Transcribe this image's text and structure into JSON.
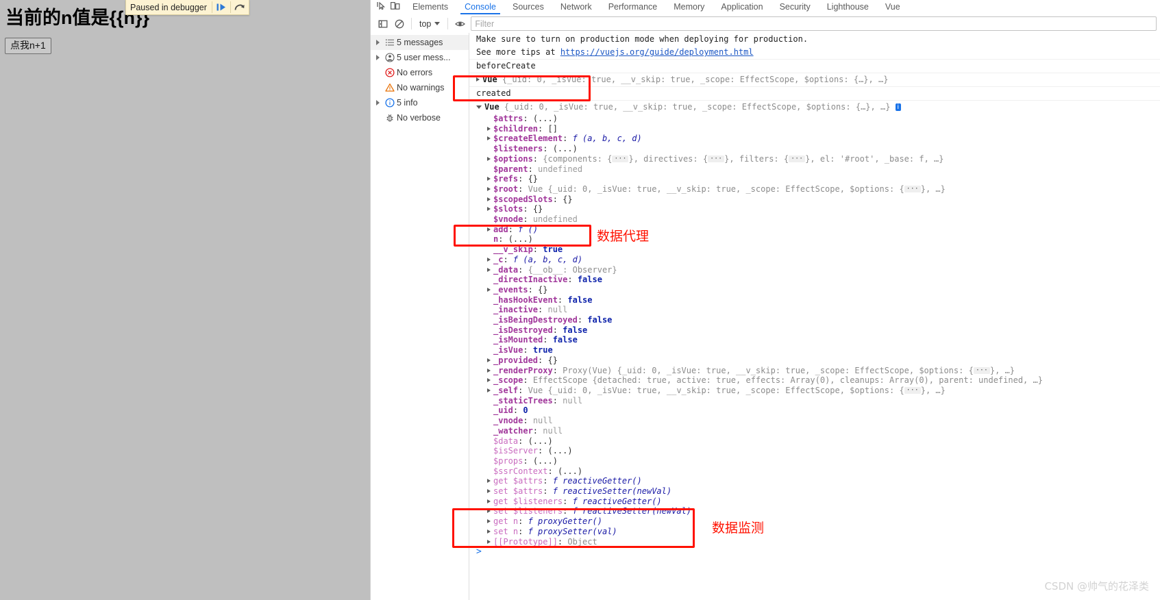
{
  "page": {
    "heading": "当前的n值是{{n}}",
    "button_label": "点我n+1",
    "background_color": "#bfbfbf"
  },
  "paused_overlay": {
    "text": "Paused in debugger",
    "resume_icon": "resume-script-icon",
    "step_over_icon": "step-over-icon"
  },
  "devtools": {
    "tabs": [
      {
        "label": "Elements",
        "active": false
      },
      {
        "label": "Console",
        "active": true
      },
      {
        "label": "Sources",
        "active": false
      },
      {
        "label": "Network",
        "active": false
      },
      {
        "label": "Performance",
        "active": false
      },
      {
        "label": "Memory",
        "active": false
      },
      {
        "label": "Application",
        "active": false
      },
      {
        "label": "Security",
        "active": false
      },
      {
        "label": "Lighthouse",
        "active": false
      },
      {
        "label": "Vue",
        "active": false
      }
    ],
    "accent_color": "#1a73e8",
    "toolbar": {
      "sidebar_toggle_icon": "sidebar-panel-icon",
      "clear_console_icon": "clear-console-icon",
      "context_label": "top",
      "eye_icon": "live-expression-eye-icon",
      "filter_placeholder": "Filter",
      "filter_value": ""
    },
    "sidebar": [
      {
        "label": "5 messages",
        "icon": "list-icon",
        "arrow": true,
        "selected": true
      },
      {
        "label": "5 user mess...",
        "icon": "user-icon",
        "arrow": true,
        "selected": false
      },
      {
        "label": "No errors",
        "icon": "error-icon",
        "arrow": false,
        "selected": false
      },
      {
        "label": "No warnings",
        "icon": "warning-icon",
        "arrow": false,
        "selected": false
      },
      {
        "label": "5 info",
        "icon": "info-icon",
        "arrow": true,
        "selected": false
      },
      {
        "label": "No verbose",
        "icon": "bug-icon",
        "arrow": false,
        "selected": false
      }
    ]
  },
  "console": {
    "messages": [
      {
        "text": "Make sure to turn on production mode when deploying for production."
      },
      {
        "text_before": "See more tips at ",
        "link": "https://vuejs.org/guide/deployment.html"
      },
      {
        "text": "beforeCreate"
      }
    ],
    "collapsed_vue_summary": {
      "tri": "closed",
      "cls": "Vue",
      "body": " {_uid: 0, _isVue: true, __v_skip: true, _scope: EffectScope, $options: {…}, …}"
    },
    "created_label": "created",
    "expanded_vue_summary": {
      "tri": "open",
      "cls": "Vue",
      "body": " {_uid: 0, _isVue: true, __v_skip: true, _scope: EffectScope, $options: {…}, …}",
      "badge": "i"
    },
    "properties": [
      {
        "arrow": "none",
        "key": "$attrs",
        "kind": "own",
        "sep": ": ",
        "value": "(...)",
        "vclass": "v-obj"
      },
      {
        "arrow": "closed",
        "key": "$children",
        "kind": "own",
        "sep": ": ",
        "value": "[]",
        "vclass": "v-obj"
      },
      {
        "arrow": "closed",
        "key": "$createElement",
        "kind": "own",
        "sep": ": ",
        "value": "f (a, b, c, d)",
        "vclass": "v-fn"
      },
      {
        "arrow": "none",
        "key": "$listeners",
        "kind": "own",
        "sep": ": ",
        "value": "(...)",
        "vclass": "v-obj"
      },
      {
        "arrow": "closed",
        "key": "$options",
        "kind": "own",
        "sep": ": ",
        "value": "{components: {…}, directives: {…}, filters: {…}, el: '#root', _base: f, …}",
        "vclass": "mixed-options"
      },
      {
        "arrow": "none",
        "key": "$parent",
        "kind": "own",
        "sep": ": ",
        "value": "undefined",
        "vclass": "v-undef"
      },
      {
        "arrow": "closed",
        "key": "$refs",
        "kind": "own",
        "sep": ": ",
        "value": "{}",
        "vclass": "v-obj"
      },
      {
        "arrow": "closed",
        "key": "$root",
        "kind": "own",
        "sep": ": ",
        "value": "Vue {_uid: 0, _isVue: true, __v_skip: true, _scope: EffectScope, $options: {…}, …}",
        "vclass": "mixed-vue"
      },
      {
        "arrow": "closed",
        "key": "$scopedSlots",
        "kind": "own",
        "sep": ": ",
        "value": "{}",
        "vclass": "v-obj"
      },
      {
        "arrow": "closed",
        "key": "$slots",
        "kind": "own",
        "sep": ": ",
        "value": "{}",
        "vclass": "v-obj"
      },
      {
        "arrow": "none",
        "key": "$vnode",
        "kind": "own",
        "sep": ": ",
        "value": "undefined",
        "vclass": "v-undef"
      },
      {
        "arrow": "closed",
        "key": "add",
        "kind": "own",
        "sep": ": ",
        "value": "f ()",
        "vclass": "v-fn"
      },
      {
        "arrow": "none",
        "key": "n",
        "kind": "own",
        "sep": ": ",
        "value": "(...)",
        "vclass": "v-obj",
        "highlight": "data-proxy"
      },
      {
        "arrow": "none",
        "key": "__v_skip",
        "kind": "own",
        "sep": ": ",
        "value": "true",
        "vclass": "v-bool"
      },
      {
        "arrow": "closed",
        "key": "_c",
        "kind": "own",
        "sep": ": ",
        "value": "f (a, b, c, d)",
        "vclass": "v-fn"
      },
      {
        "arrow": "closed",
        "key": "_data",
        "kind": "own",
        "sep": ": ",
        "value": "{__ob__: Observer}",
        "vclass": "mixed-data"
      },
      {
        "arrow": "none",
        "key": "_directInactive",
        "kind": "own",
        "sep": ": ",
        "value": "false",
        "vclass": "v-bool"
      },
      {
        "arrow": "closed",
        "key": "_events",
        "kind": "own",
        "sep": ": ",
        "value": "{}",
        "vclass": "v-obj"
      },
      {
        "arrow": "none",
        "key": "_hasHookEvent",
        "kind": "own",
        "sep": ": ",
        "value": "false",
        "vclass": "v-bool"
      },
      {
        "arrow": "none",
        "key": "_inactive",
        "kind": "own",
        "sep": ": ",
        "value": "null",
        "vclass": "v-null"
      },
      {
        "arrow": "none",
        "key": "_isBeingDestroyed",
        "kind": "own",
        "sep": ": ",
        "value": "false",
        "vclass": "v-bool"
      },
      {
        "arrow": "none",
        "key": "_isDestroyed",
        "kind": "own",
        "sep": ": ",
        "value": "false",
        "vclass": "v-bool"
      },
      {
        "arrow": "none",
        "key": "_isMounted",
        "kind": "own",
        "sep": ": ",
        "value": "false",
        "vclass": "v-bool"
      },
      {
        "arrow": "none",
        "key": "_isVue",
        "kind": "own",
        "sep": ": ",
        "value": "true",
        "vclass": "v-bool"
      },
      {
        "arrow": "closed",
        "key": "_provided",
        "kind": "own",
        "sep": ": ",
        "value": "{}",
        "vclass": "v-obj"
      },
      {
        "arrow": "closed",
        "key": "_renderProxy",
        "kind": "own",
        "sep": ": ",
        "value": "Proxy(Vue) {_uid: 0, _isVue: true, __v_skip: true, _scope: EffectScope, $options: {…}, …}",
        "vclass": "mixed-proxy"
      },
      {
        "arrow": "closed",
        "key": "_scope",
        "kind": "own",
        "sep": ": ",
        "value": "EffectScope {detached: true, active: true, effects: Array(0), cleanups: Array(0), parent: undefined, …}",
        "vclass": "mixed-scope"
      },
      {
        "arrow": "closed",
        "key": "_self",
        "kind": "own",
        "sep": ": ",
        "value": "Vue {_uid: 0, _isVue: true, __v_skip: true, _scope: EffectScope, $options: {…}, …}",
        "vclass": "mixed-self"
      },
      {
        "arrow": "none",
        "key": "_staticTrees",
        "kind": "own",
        "sep": ": ",
        "value": "null",
        "vclass": "v-null"
      },
      {
        "arrow": "none",
        "key": "_uid",
        "kind": "own",
        "sep": ": ",
        "value": "0",
        "vclass": "v-num"
      },
      {
        "arrow": "none",
        "key": "_vnode",
        "kind": "own",
        "sep": ": ",
        "value": "null",
        "vclass": "v-null"
      },
      {
        "arrow": "none",
        "key": "_watcher",
        "kind": "own",
        "sep": ": ",
        "value": "null",
        "vclass": "v-null"
      },
      {
        "arrow": "none",
        "key": "$data",
        "kind": "inh",
        "sep": ": ",
        "value": "(...)",
        "vclass": "v-obj"
      },
      {
        "arrow": "none",
        "key": "$isServer",
        "kind": "inh",
        "sep": ": ",
        "value": "(...)",
        "vclass": "v-obj"
      },
      {
        "arrow": "none",
        "key": "$props",
        "kind": "inh",
        "sep": ": ",
        "value": "(...)",
        "vclass": "v-obj"
      },
      {
        "arrow": "none",
        "key": "$ssrContext",
        "kind": "inh",
        "sep": ": ",
        "value": "(...)",
        "vclass": "v-obj"
      },
      {
        "arrow": "closed",
        "key": "get $attrs",
        "kind": "inh",
        "sep": ": ",
        "value": "f reactiveGetter()",
        "vclass": "v-fn"
      },
      {
        "arrow": "closed",
        "key": "set $attrs",
        "kind": "inh",
        "sep": ": ",
        "value": "f reactiveSetter(newVal)",
        "vclass": "v-fn"
      },
      {
        "arrow": "closed",
        "key": "get $listeners",
        "kind": "inh",
        "sep": ": ",
        "value": "f reactiveGetter()",
        "vclass": "v-fn"
      },
      {
        "arrow": "closed",
        "key": "set $listeners",
        "kind": "inh",
        "sep": ": ",
        "value": "f reactiveSetter(newVal)",
        "vclass": "v-fn"
      },
      {
        "arrow": "closed",
        "key": "get n",
        "kind": "inh",
        "sep": ": ",
        "value": "f proxyGetter()",
        "vclass": "v-fn",
        "highlight": "data-watch"
      },
      {
        "arrow": "closed",
        "key": "set n",
        "kind": "inh",
        "sep": ": ",
        "value": "f proxySetter(val)",
        "vclass": "v-fn",
        "highlight": "data-watch"
      },
      {
        "arrow": "closed",
        "key": "[[Prototype]]",
        "kind": "inh",
        "sep": ": ",
        "value": "Object",
        "vclass": "v-dim",
        "highlight": "data-watch"
      }
    ],
    "prompt": ">"
  },
  "annotations": [
    {
      "id": "created-box",
      "label": ""
    },
    {
      "id": "data-proxy-box",
      "label": "数据代理"
    },
    {
      "id": "data-watch-box",
      "label": "数据监测"
    }
  ],
  "watermark": "CSDN @帅气的花泽类"
}
